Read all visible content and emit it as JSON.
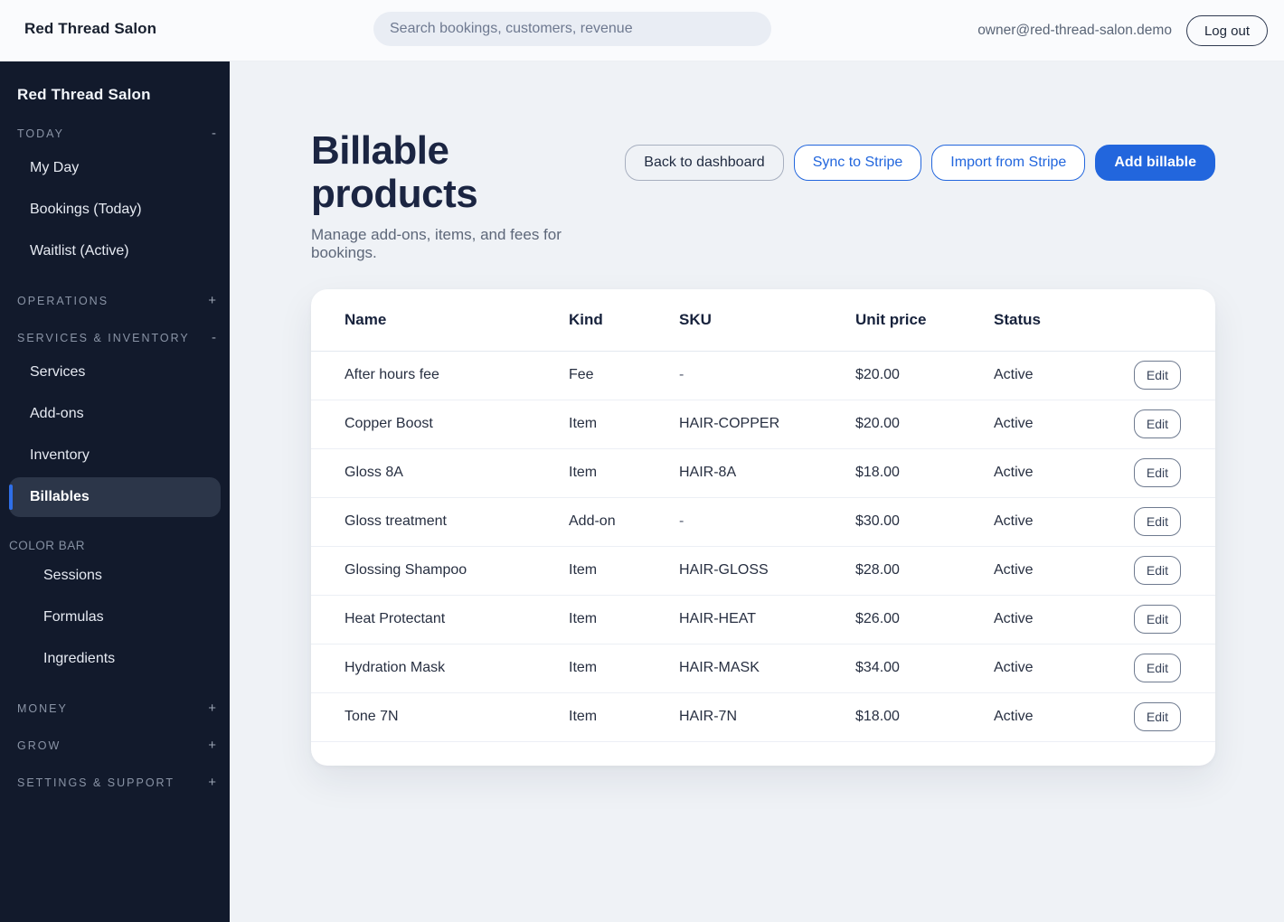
{
  "topbar": {
    "brand": "Red Thread Salon",
    "search_placeholder": "Search bookings, customers, revenue",
    "user_email": "owner@red-thread-salon.demo",
    "logout_label": "Log out"
  },
  "sidebar": {
    "title": "Red Thread Salon",
    "sections": [
      {
        "label": "TODAY",
        "toggle": "-",
        "items": [
          {
            "label": "My Day"
          },
          {
            "label": "Bookings (Today)"
          },
          {
            "label": "Waitlist (Active)"
          }
        ]
      },
      {
        "label": "OPERATIONS",
        "toggle": "+",
        "items": []
      },
      {
        "label": "SERVICES & INVENTORY",
        "toggle": "-",
        "items": [
          {
            "label": "Services"
          },
          {
            "label": "Add-ons"
          },
          {
            "label": "Inventory"
          },
          {
            "label": "Billables",
            "active": true
          }
        ]
      },
      {
        "label": "COLOR BAR",
        "toggle": "",
        "items": [
          {
            "label": "Sessions"
          },
          {
            "label": "Formulas"
          },
          {
            "label": "Ingredients"
          }
        ]
      },
      {
        "label": "MONEY",
        "toggle": "+",
        "items": []
      },
      {
        "label": "GROW",
        "toggle": "+",
        "items": []
      },
      {
        "label": "SETTINGS & SUPPORT",
        "toggle": "+",
        "items": []
      }
    ]
  },
  "page": {
    "title": "Billable products",
    "subtitle": "Manage add-ons, items, and fees for bookings.",
    "actions": {
      "back": "Back to dashboard",
      "sync": "Sync to Stripe",
      "import": "Import from Stripe",
      "add": "Add billable"
    }
  },
  "table": {
    "columns": [
      "Name",
      "Kind",
      "SKU",
      "Unit price",
      "Status"
    ],
    "edit_label": "Edit",
    "rows": [
      {
        "name": "After hours fee",
        "kind": "Fee",
        "sku": "-",
        "unit_price": "$20.00",
        "status": "Active"
      },
      {
        "name": "Copper Boost",
        "kind": "Item",
        "sku": "HAIR-COPPER",
        "unit_price": "$20.00",
        "status": "Active"
      },
      {
        "name": "Gloss 8A",
        "kind": "Item",
        "sku": "HAIR-8A",
        "unit_price": "$18.00",
        "status": "Active"
      },
      {
        "name": "Gloss treatment",
        "kind": "Add-on",
        "sku": "-",
        "unit_price": "$30.00",
        "status": "Active"
      },
      {
        "name": "Glossing Shampoo",
        "kind": "Item",
        "sku": "HAIR-GLOSS",
        "unit_price": "$28.00",
        "status": "Active"
      },
      {
        "name": "Heat Protectant",
        "kind": "Item",
        "sku": "HAIR-HEAT",
        "unit_price": "$26.00",
        "status": "Active"
      },
      {
        "name": "Hydration Mask",
        "kind": "Item",
        "sku": "HAIR-MASK",
        "unit_price": "$34.00",
        "status": "Active"
      },
      {
        "name": "Tone 7N",
        "kind": "Item",
        "sku": "HAIR-7N",
        "unit_price": "$18.00",
        "status": "Active"
      }
    ]
  },
  "colors": {
    "accent_blue": "#2266dd",
    "sidebar_bg": "#121a2c",
    "active_item_bg": "#2c3649",
    "active_indicator": "#2f6fe8",
    "page_bg": "#eff2f6",
    "card_bg": "#ffffff"
  }
}
